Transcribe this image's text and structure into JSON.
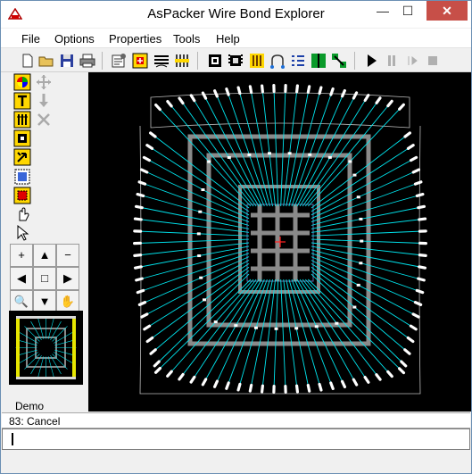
{
  "window": {
    "title": "AsPacker Wire Bond Explorer",
    "controls": {
      "minimize": "—",
      "maximize": "☐",
      "close": "✕"
    }
  },
  "menu": {
    "file": "File",
    "options": "Options",
    "properties": "Properties",
    "tools": "Tools",
    "help": "Help"
  },
  "toolbar": {
    "icons": [
      "new-document-icon",
      "open-folder-icon",
      "save-icon",
      "print-icon",
      "properties-icon",
      "add-component-icon",
      "layers-icon",
      "bond-wires-icon",
      "select-chip-icon",
      "die-pad-icon",
      "fingers-icon",
      "wire-arc-icon",
      "wire-list-icon",
      "green-bars-icon",
      "route-icon",
      "play-icon",
      "pause-icon",
      "step-icon",
      "stop-icon"
    ]
  },
  "leftpanel": {
    "tools": [
      "color-wheel-icon",
      "move-icon",
      "text-icon",
      "pin-down-icon",
      "bond-fingers-icon",
      "delete-icon",
      "chip-select-icon",
      "flip-icon",
      "region-icon",
      "grid-select-icon",
      "hand-pointer-icon",
      "arrow-pointer-icon"
    ],
    "nav": {
      "plus": "+",
      "up": "▲",
      "minus": "−",
      "left": "◀",
      "center": "□",
      "right": "▶",
      "zoom": "🔍",
      "down": "▼",
      "pan": "✋"
    },
    "thumbnail_label": "Demo"
  },
  "colors": {
    "wire": "#00e5ee",
    "frame": "#8a8a8a",
    "finger": "#ffffff",
    "crosshair": "#ff2020",
    "background": "#000000"
  },
  "status": {
    "message": "83: Cancel"
  },
  "command": {
    "value": ""
  }
}
